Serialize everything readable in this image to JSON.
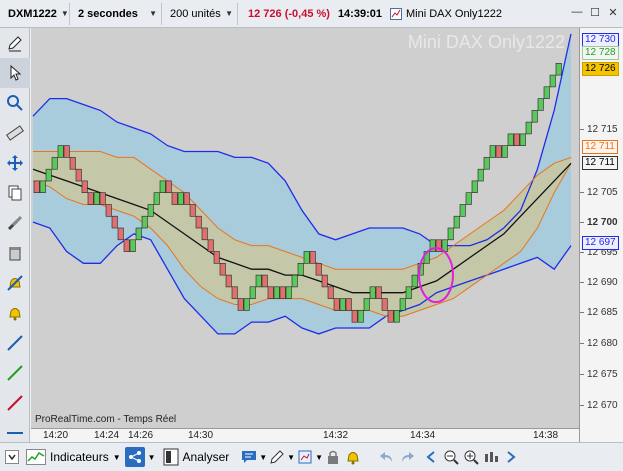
{
  "toolbar": {
    "instrument": "DXM1222",
    "timeframe": "2 secondes",
    "units": "200 unités",
    "price_change": "12 726 (-0,45 %)",
    "clock": "14:39:01",
    "window_name": "Mini DAX Only1222"
  },
  "chart": {
    "watermark": "Mini DAX Only1222",
    "credit": "ProRealTime.com - Temps Réel",
    "colors": {
      "background": "#cfcfcf",
      "up_candle": "#5ac85a",
      "down_candle": "#e07070",
      "outer_band": "#1f2ce8",
      "inner_band": "#e8741f",
      "moving_average": "#111111",
      "outer_fill": "#a8ccdc",
      "inner_fill": "#c4c8a8",
      "highlight_ellipse": "#e020e0"
    }
  },
  "yaxis": {
    "ticks": [
      "12 715",
      "12 705",
      "12 700",
      "12 695",
      "12 690",
      "12 685",
      "12 680",
      "12 675",
      "12 670"
    ],
    "tags": {
      "t12730": "12 730",
      "t12728": "12 728",
      "t12726": "12 726",
      "t12711a": "12 711",
      "t12711b": "12 711",
      "t12697": "12 697"
    }
  },
  "xaxis": {
    "ticks": [
      "14:20",
      "14:24",
      "14:26",
      "14:30",
      "14:32",
      "14:34",
      "14:38"
    ]
  },
  "bottombar": {
    "indicators": "Indicateurs",
    "analyser": "Analyser"
  },
  "chart_data": {
    "type": "candlestick",
    "title": "Mini DAX Only1222",
    "ylim": [
      12666,
      12734
    ],
    "x_ticks": [
      "14:20",
      "14:24",
      "14:26",
      "14:30",
      "14:32",
      "14:34",
      "14:38"
    ],
    "candles": [
      {
        "o": 12708,
        "c": 12706
      },
      {
        "o": 12706,
        "c": 12708
      },
      {
        "o": 12708,
        "c": 12710
      },
      {
        "o": 12710,
        "c": 12712
      },
      {
        "o": 12712,
        "c": 12714
      },
      {
        "o": 12714,
        "c": 12712
      },
      {
        "o": 12712,
        "c": 12710
      },
      {
        "o": 12710,
        "c": 12708
      },
      {
        "o": 12708,
        "c": 12706
      },
      {
        "o": 12706,
        "c": 12704
      },
      {
        "o": 12704,
        "c": 12706
      },
      {
        "o": 12706,
        "c": 12704
      },
      {
        "o": 12704,
        "c": 12702
      },
      {
        "o": 12702,
        "c": 12700
      },
      {
        "o": 12700,
        "c": 12698
      },
      {
        "o": 12698,
        "c": 12696
      },
      {
        "o": 12696,
        "c": 12698
      },
      {
        "o": 12698,
        "c": 12700
      },
      {
        "o": 12700,
        "c": 12702
      },
      {
        "o": 12702,
        "c": 12704
      },
      {
        "o": 12704,
        "c": 12706
      },
      {
        "o": 12706,
        "c": 12708
      },
      {
        "o": 12708,
        "c": 12706
      },
      {
        "o": 12706,
        "c": 12704
      },
      {
        "o": 12704,
        "c": 12706
      },
      {
        "o": 12706,
        "c": 12704
      },
      {
        "o": 12704,
        "c": 12702
      },
      {
        "o": 12702,
        "c": 12700
      },
      {
        "o": 12700,
        "c": 12698
      },
      {
        "o": 12698,
        "c": 12696
      },
      {
        "o": 12696,
        "c": 12694
      },
      {
        "o": 12694,
        "c": 12692
      },
      {
        "o": 12692,
        "c": 12690
      },
      {
        "o": 12690,
        "c": 12688
      },
      {
        "o": 12688,
        "c": 12686
      },
      {
        "o": 12686,
        "c": 12688
      },
      {
        "o": 12688,
        "c": 12690
      },
      {
        "o": 12690,
        "c": 12692
      },
      {
        "o": 12692,
        "c": 12690
      },
      {
        "o": 12690,
        "c": 12688
      },
      {
        "o": 12688,
        "c": 12690
      },
      {
        "o": 12690,
        "c": 12688
      },
      {
        "o": 12688,
        "c": 12690
      },
      {
        "o": 12690,
        "c": 12692
      },
      {
        "o": 12692,
        "c": 12694
      },
      {
        "o": 12694,
        "c": 12696
      },
      {
        "o": 12696,
        "c": 12694
      },
      {
        "o": 12694,
        "c": 12692
      },
      {
        "o": 12692,
        "c": 12690
      },
      {
        "o": 12690,
        "c": 12688
      },
      {
        "o": 12688,
        "c": 12686
      },
      {
        "o": 12686,
        "c": 12688
      },
      {
        "o": 12688,
        "c": 12686
      },
      {
        "o": 12686,
        "c": 12684
      },
      {
        "o": 12684,
        "c": 12686
      },
      {
        "o": 12686,
        "c": 12688
      },
      {
        "o": 12688,
        "c": 12690
      },
      {
        "o": 12690,
        "c": 12688
      },
      {
        "o": 12688,
        "c": 12686
      },
      {
        "o": 12686,
        "c": 12684
      },
      {
        "o": 12684,
        "c": 12686
      },
      {
        "o": 12686,
        "c": 12688
      },
      {
        "o": 12688,
        "c": 12690
      },
      {
        "o": 12690,
        "c": 12692
      },
      {
        "o": 12692,
        "c": 12694
      },
      {
        "o": 12694,
        "c": 12696
      },
      {
        "o": 12696,
        "c": 12698
      },
      {
        "o": 12698,
        "c": 12696
      },
      {
        "o": 12696,
        "c": 12698
      },
      {
        "o": 12698,
        "c": 12700
      },
      {
        "o": 12700,
        "c": 12702
      },
      {
        "o": 12702,
        "c": 12704
      },
      {
        "o": 12704,
        "c": 12706
      },
      {
        "o": 12706,
        "c": 12708
      },
      {
        "o": 12708,
        "c": 12710
      },
      {
        "o": 12710,
        "c": 12712
      },
      {
        "o": 12712,
        "c": 12714
      },
      {
        "o": 12714,
        "c": 12712
      },
      {
        "o": 12712,
        "c": 12714
      },
      {
        "o": 12714,
        "c": 12716
      },
      {
        "o": 12716,
        "c": 12714
      },
      {
        "o": 12714,
        "c": 12716
      },
      {
        "o": 12716,
        "c": 12718
      },
      {
        "o": 12718,
        "c": 12720
      },
      {
        "o": 12720,
        "c": 12722
      },
      {
        "o": 12722,
        "c": 12724
      },
      {
        "o": 12724,
        "c": 12726
      },
      {
        "o": 12726,
        "c": 12728
      }
    ],
    "bands": {
      "outer_upper": [
        12719,
        12722,
        12722,
        12721,
        12720,
        12718,
        12717,
        12716,
        12714,
        12713,
        12713,
        12713,
        12712,
        12712,
        12711,
        12708,
        12703,
        12699,
        12698,
        12699,
        12700,
        12700,
        12700,
        12699,
        12697,
        12697,
        12697,
        12698,
        12700,
        12703,
        12710,
        12720,
        12733
      ],
      "outer_lower": [
        12701,
        12700,
        12696,
        12694,
        12694,
        12697,
        12699,
        12698,
        12693,
        12688,
        12685,
        12682,
        12682,
        12684,
        12684,
        12685,
        12683,
        12682,
        12683,
        12683,
        12683,
        12685,
        12686,
        12687,
        12689,
        12690,
        12691,
        12692,
        12693,
        12694,
        12695,
        12693,
        12697
      ],
      "inner_upper": [
        12713,
        12713,
        12713,
        12713,
        12713,
        12712,
        12712,
        12710,
        12708,
        12706,
        12703,
        12700,
        12698,
        12697,
        12697,
        12696,
        12695,
        12694,
        12693,
        12693,
        12693,
        12693,
        12693,
        12694,
        12695,
        12697,
        12699,
        12701,
        12703,
        12706,
        12709,
        12711,
        12712
      ],
      "inner_lower": [
        12708,
        12707,
        12705,
        12704,
        12704,
        12703,
        12702,
        12700,
        12697,
        12693,
        12690,
        12688,
        12687,
        12687,
        12688,
        12688,
        12688,
        12687,
        12686,
        12686,
        12686,
        12685,
        12685,
        12686,
        12687,
        12688,
        12690,
        12692,
        12694,
        12696,
        12700,
        12706,
        12711
      ],
      "ma": [
        12710,
        12709,
        12708,
        12707,
        12706,
        12705,
        12704,
        12703,
        12701,
        12699,
        12697,
        12695,
        12694,
        12693,
        12693,
        12692,
        12692,
        12691,
        12690,
        12689,
        12689,
        12689,
        12689,
        12690,
        12691,
        12693,
        12695,
        12697,
        12699,
        12702,
        12705,
        12708,
        12711
      ]
    }
  }
}
